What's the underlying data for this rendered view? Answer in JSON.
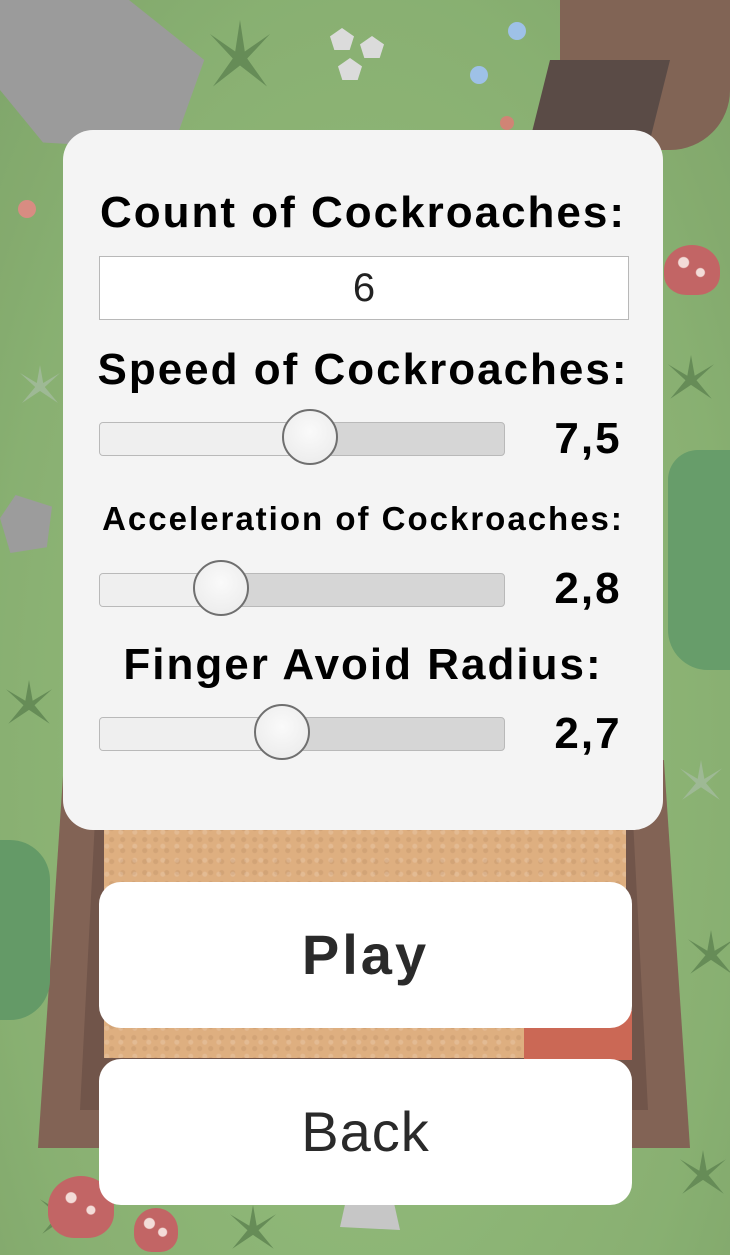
{
  "settings": {
    "count": {
      "label": "Count of Cockroaches:",
      "value": "6"
    },
    "speed": {
      "label": "Speed of Cockroaches:",
      "value_text": "7,5",
      "slider_fraction": 0.52
    },
    "acceleration": {
      "label": "Acceleration of Cockroaches:",
      "value_text": "2,8",
      "slider_fraction": 0.3
    },
    "finger_radius": {
      "label": "Finger Avoid Radius:",
      "value_text": "2,7",
      "slider_fraction": 0.45
    }
  },
  "buttons": {
    "play_label": "Play",
    "back_label": "Back"
  },
  "colors": {
    "panel_bg": "#f4f4f4",
    "button_bg": "#ffffff",
    "slider_track": "#d6d6d6",
    "slider_fill": "#efefef",
    "grass": "#7fae63"
  }
}
